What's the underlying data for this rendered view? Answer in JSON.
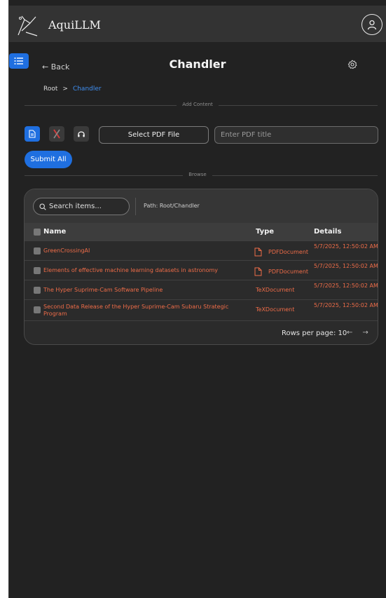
{
  "header": {
    "brand": "AquiLLM"
  },
  "page": {
    "back_label": "← Back",
    "title": "Chandler",
    "breadcrumb": {
      "root": "Root",
      "separator": ">",
      "current": "Chandler"
    }
  },
  "add_content": {
    "section_label": "Add Content",
    "select_pdf_label": "Select PDF File",
    "title_placeholder": "Enter PDF title",
    "submit_label": "Submit All"
  },
  "browse": {
    "section_label": "Browse",
    "search_placeholder": "Search items...",
    "path_label": "Path: Root/Chandler",
    "columns": {
      "name": "Name",
      "type": "Type",
      "details": "Details"
    },
    "rows": [
      {
        "name": "GreenCrossingAI",
        "type": "PDFDocument",
        "details": "5/7/2025, 12:50:02 AM"
      },
      {
        "name": "Elements of effective machine learning datasets in astronomy",
        "type": "PDFDocument",
        "details": "5/7/2025, 12:50:02 AM"
      },
      {
        "name": "The Hyper Suprime-Cam Software Pipeline",
        "type": "TeXDocument",
        "details": "5/7/2025, 12:50:02 AM"
      },
      {
        "name": "Second Data Release of the Hyper Suprime-Cam Subaru Strategic Program",
        "type": "TeXDocument",
        "details": "5/7/2025, 12:50:02 AM"
      }
    ],
    "rows_per_page_label": "Rows per page: 10",
    "prev_icon": "←",
    "next_icon": "→"
  },
  "colors": {
    "accent": "#1f6fe0",
    "link": "#3f8ff2",
    "row_text": "#ee6c48",
    "background": "#222222",
    "header": "#333333"
  }
}
